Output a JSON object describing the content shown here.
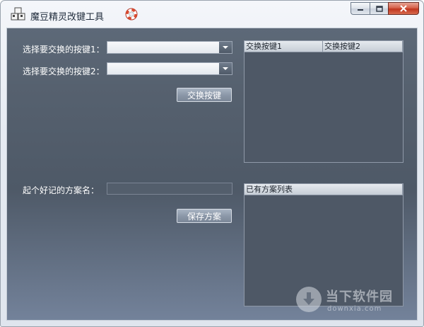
{
  "window": {
    "title": "魔豆精灵改键工具"
  },
  "swap_section": {
    "key1_label": "选择要交换的按键1：",
    "key1_value": "",
    "key2_label": "选择要交换的按键2：",
    "key2_value": "",
    "swap_button_label": "交换按键",
    "table": {
      "columns": [
        "交换按键1",
        "交换按键2"
      ],
      "rows": []
    }
  },
  "scheme_section": {
    "name_label": "起个好记的方案名：",
    "name_value": "",
    "save_button_label": "保存方案",
    "list_header": "已有方案列表",
    "items": []
  },
  "watermark": {
    "brand": "当下软件园",
    "site": "downxia.com"
  },
  "colors": {
    "client_background": "#56616f",
    "header_background": "#d4dae1",
    "close_button": "#c8402a"
  }
}
